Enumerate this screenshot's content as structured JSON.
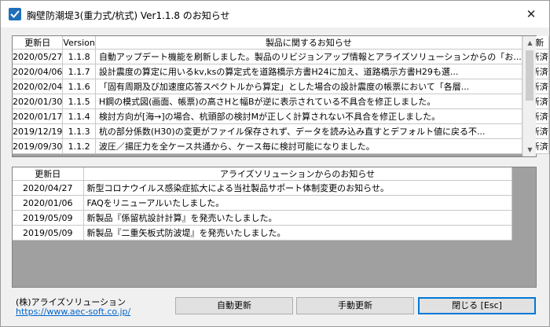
{
  "window": {
    "title": "胸壁防潮堤3(重力式/杭式) Ver1.1.8 のお知らせ",
    "close_glyph": "✕"
  },
  "product_notices": {
    "headers": [
      "更新日",
      "Version",
      "製品に関するお知らせ",
      "更新"
    ],
    "rows": [
      {
        "date": "2020/05/27",
        "version": "1.1.8",
        "notice": "自動アップデート機能を刷新しました。製品のリビジョンアップ情報とアライズソリューションからの「お...",
        "status": "更新済"
      },
      {
        "date": "2020/04/06",
        "version": "1.1.7",
        "notice": "設計震度の算定に用いるkv,ksの算定式を道路橋示方書H24に加え、道路橋示方書H29も選...",
        "status": "更新済"
      },
      {
        "date": "2020/02/04",
        "version": "1.1.6",
        "notice": "「固有周期及び加速度応答スペクトルから算定」とした場合の設計震度の帳票において「各層...",
        "status": "更新済"
      },
      {
        "date": "2020/01/30",
        "version": "1.1.5",
        "notice": "H鋼の模式図(画面、帳票)の高さHと幅Bが逆に表示されている不具合を修正しました。",
        "status": "更新済"
      },
      {
        "date": "2020/01/17",
        "version": "1.1.4",
        "notice": "検討方向が[海→]の場合、杭頭部の検討Mが正しく計算されない不具合を修正しました。",
        "status": "更新済"
      },
      {
        "date": "2019/12/19",
        "version": "1.1.3",
        "notice": "杭の部分係数(H30)の変更がファイル保存されず、データを読み込み直すとデフォルト値に戻る不...",
        "status": "更新済"
      },
      {
        "date": "2019/09/30",
        "version": "1.1.2",
        "notice": "波圧／揚圧力を全ケース共通から、ケース毎に検討可能になりました。",
        "status": "更新済"
      }
    ]
  },
  "company_notices": {
    "headers": [
      "更新日",
      "アライズソリューションからのお知らせ"
    ],
    "rows": [
      {
        "date": "2020/04/27",
        "notice": "新型コロナウイルス感染症拡大による当社製品サポート体制変更のお知らせ。"
      },
      {
        "date": "2020/01/06",
        "notice": "FAQをリニューアルいたしました。"
      },
      {
        "date": "2019/05/09",
        "notice": "新製品『係留杭設計計算』を発売いたしました。"
      },
      {
        "date": "2019/05/09",
        "notice": "新製品『二重矢板式防波堤』を発売いたしました。"
      }
    ]
  },
  "footer": {
    "company": "(株)アライズソリューション",
    "url": "https://www.aec-soft.co.jp/",
    "auto_update_label": "自動更新",
    "manual_update_label": "手動更新",
    "close_label": "閉じる [Esc]"
  },
  "colors": {
    "accent": "#0078d7",
    "link": "#0066cc",
    "empty_area": "#a0a0a0"
  }
}
